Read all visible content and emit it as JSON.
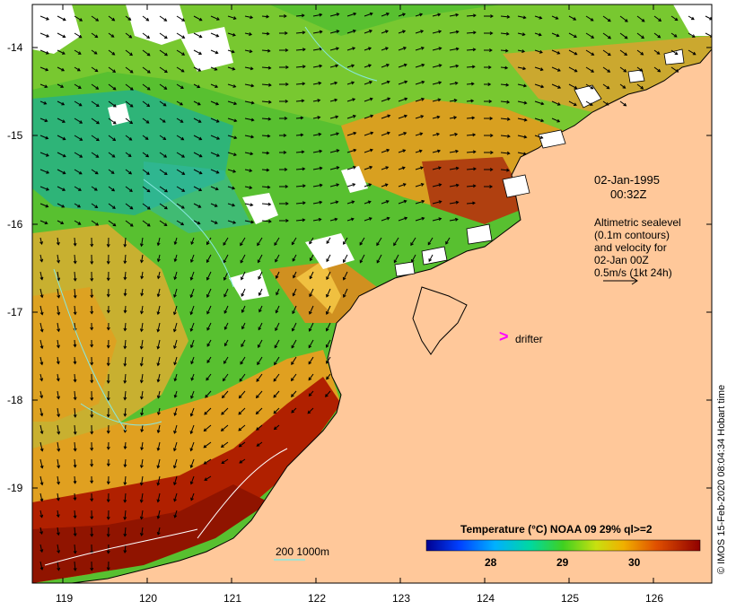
{
  "map": {
    "time_label_line1": "02-Jan-1995",
    "time_label_line2": "00:32Z",
    "legend_lines": [
      "Altimetric sealevel",
      "(0.1m contours)",
      "and velocity for",
      "02-Jan 00Z",
      "0.5m/s (1kt 24h)"
    ],
    "drifter_symbol": ">",
    "drifter_label": "drifter",
    "depth_label": "200  1000m",
    "credit": "© IMOS 15-Feb-2020 08:04:34 Hobart time",
    "lat_ticks": [
      "-14",
      "-15",
      "-16",
      "-17",
      "-18",
      "-19"
    ],
    "lon_ticks": [
      "119",
      "120",
      "121",
      "122",
      "123",
      "124",
      "125",
      "126"
    ],
    "colorbar": {
      "title": "Temperature (°C) NOAA 09 29% ql>=2",
      "ticks": [
        "28",
        "29",
        "30"
      ]
    },
    "colors": {
      "land": "#ffc89a",
      "coast": "#000000",
      "drifter": "#ff00ff",
      "contour": "#88e8e0",
      "hot": "#a01800",
      "warm": "#e0a020",
      "mid": "#60c830",
      "cool": "#18b0a0"
    }
  }
}
